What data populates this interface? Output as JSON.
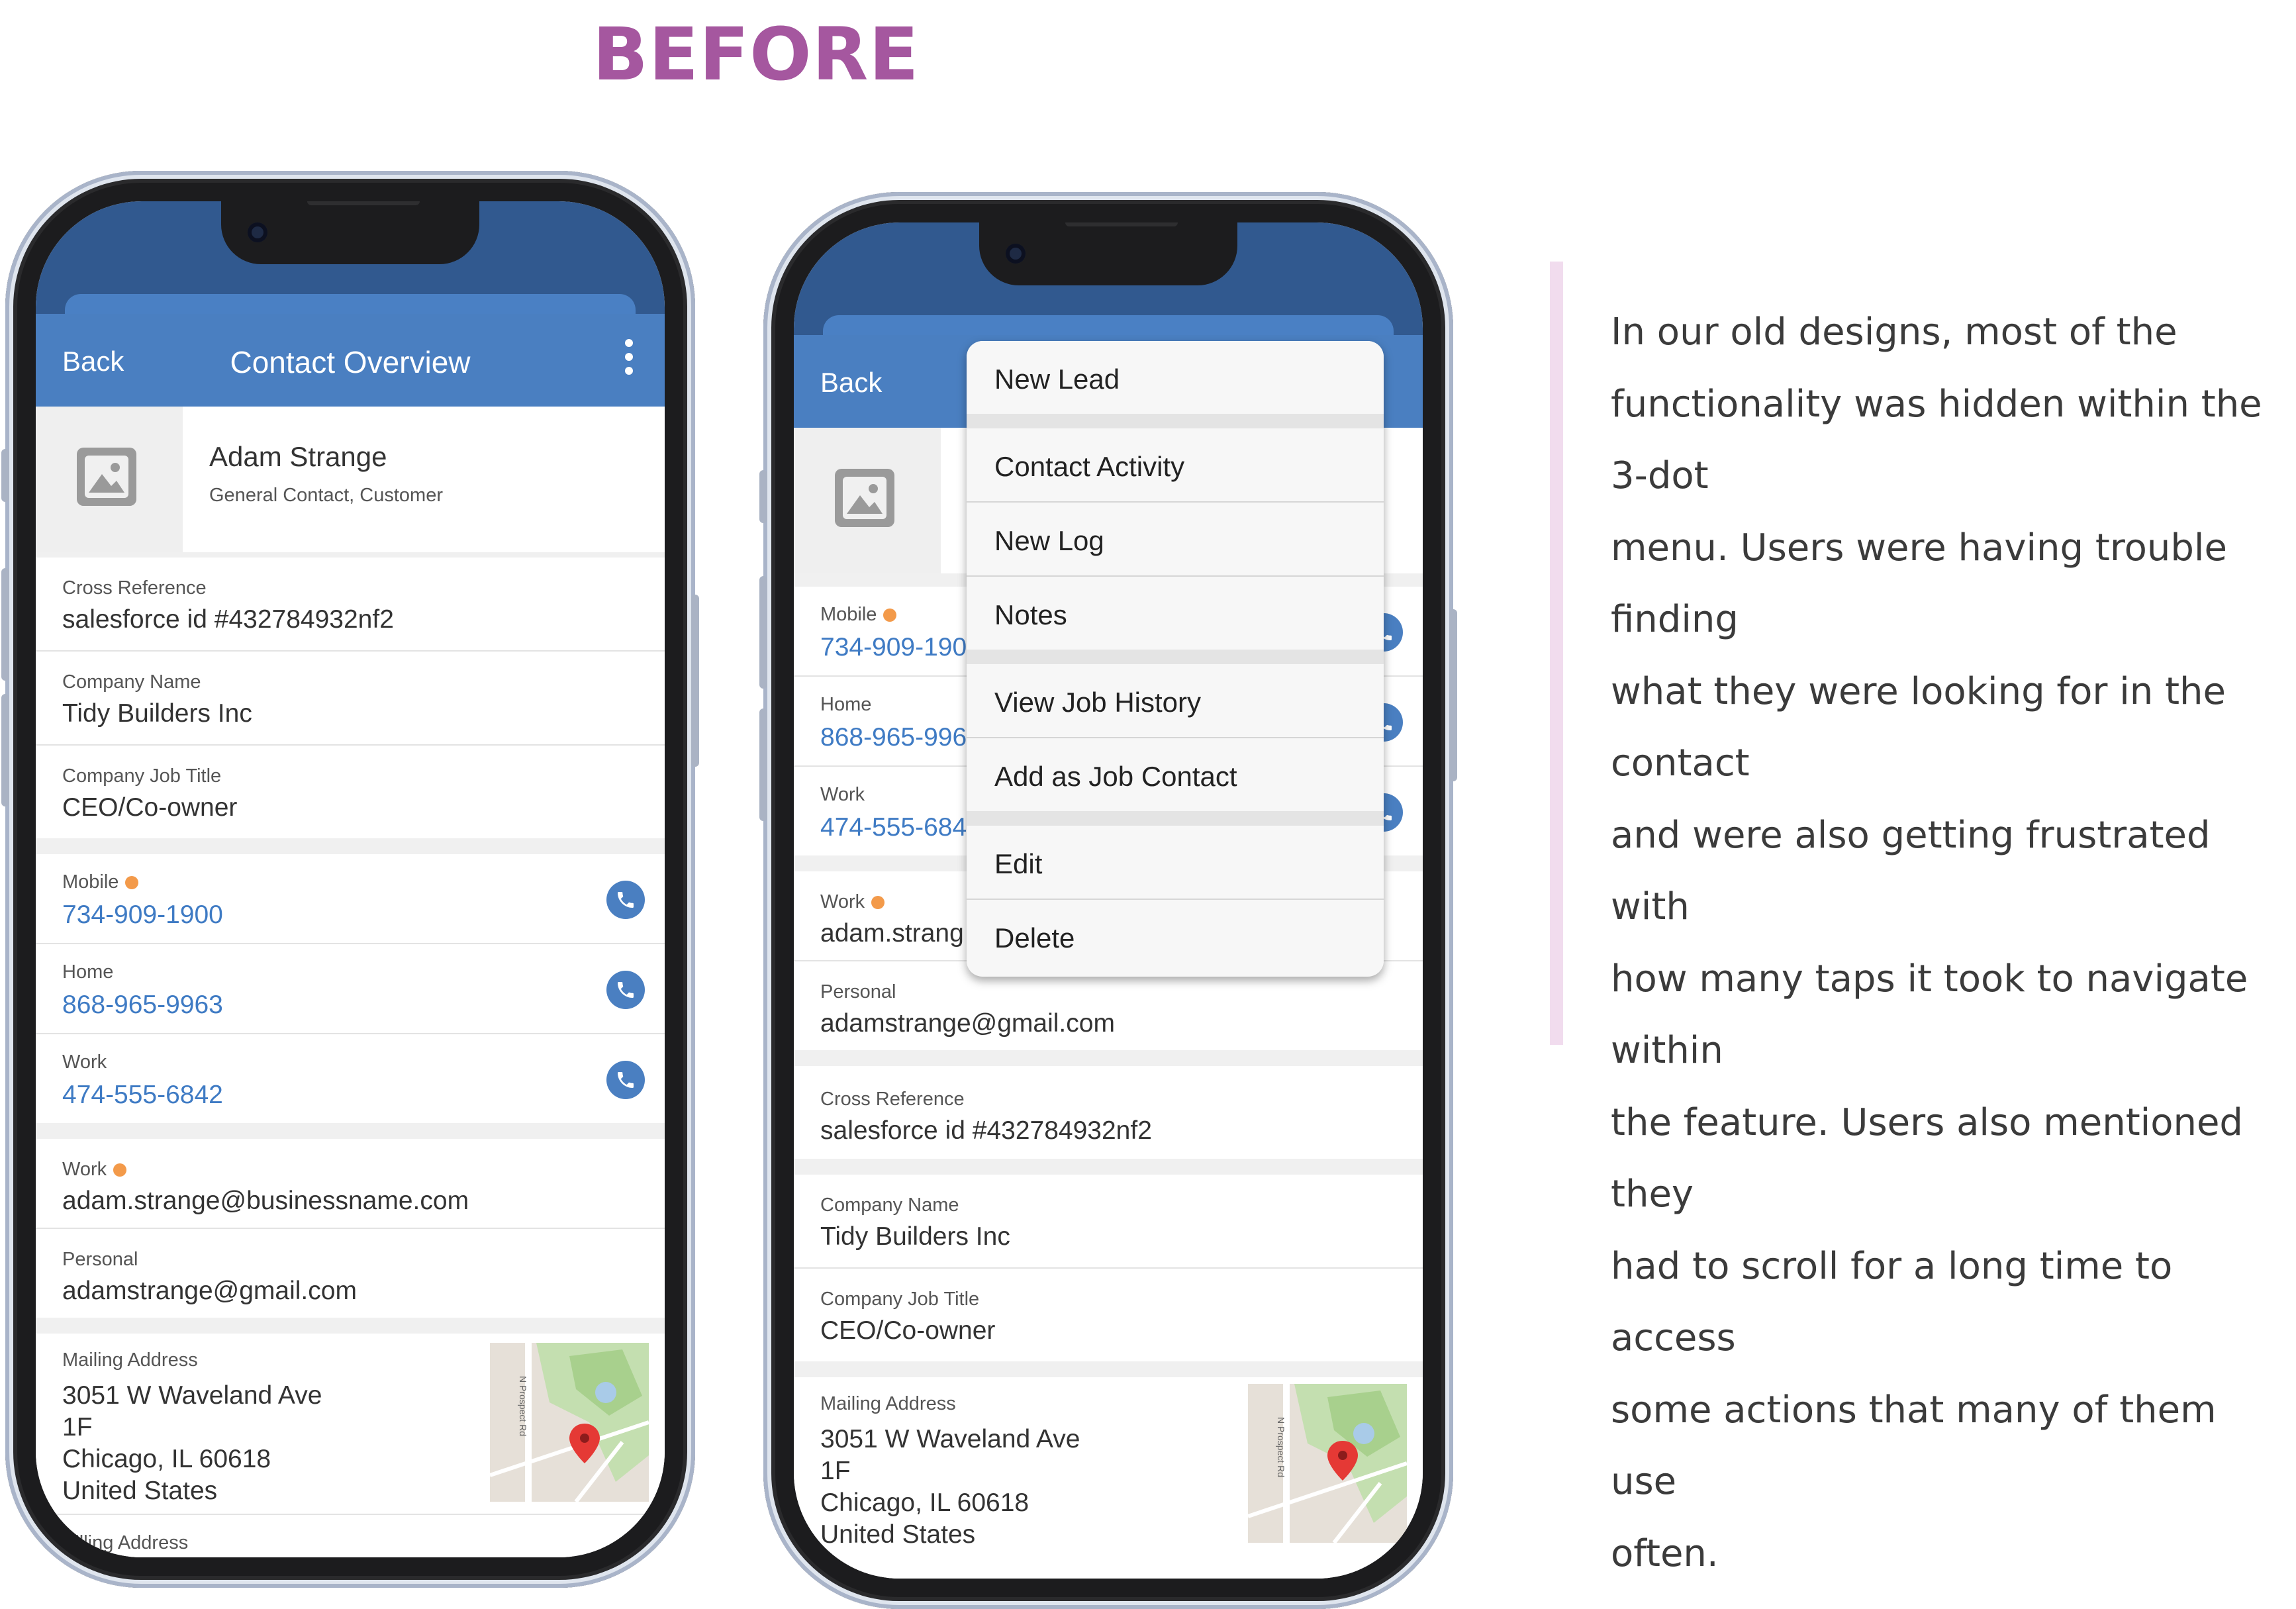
{
  "heading": "BEFORE",
  "phone1": {
    "back": "Back",
    "title": "Contact Overview",
    "name": "Adam Strange",
    "subtitle": "General Contact, Customer",
    "fields": [
      {
        "label": "Cross Reference",
        "value": "salesforce id #432784932nf2"
      },
      {
        "label": "Company Name",
        "value": "Tidy Builders Inc"
      },
      {
        "label": "Company Job Title",
        "value": "CEO/Co-owner"
      }
    ],
    "phones": [
      {
        "label": "Mobile",
        "value": "734-909-1900"
      },
      {
        "label": "Home",
        "value": "868-965-9963"
      },
      {
        "label": "Work",
        "value": "474-555-6842"
      }
    ],
    "emails": [
      {
        "label": "Work",
        "value": "adam.strange@businessname.com"
      },
      {
        "label": "Personal",
        "value": "adamstrange@gmail.com"
      }
    ],
    "mailing": {
      "label": "Mailing Address",
      "line1": "3051 W Waveland Ave",
      "line2": "1F",
      "line3": "Chicago, IL 60618",
      "line4": "United States"
    },
    "billing_label": "Billing Address",
    "map_road": "N Prospect Rd"
  },
  "phone2": {
    "back": "Back",
    "phones": [
      {
        "label": "Mobile",
        "value": "734-909-190"
      },
      {
        "label": "Home",
        "value": "868-965-996"
      },
      {
        "label": "Work",
        "value": "474-555-684"
      }
    ],
    "email_work": {
      "label": "Work",
      "value": "adam.strang"
    },
    "email_personal": {
      "label": "Personal",
      "value": "adamstrange@gmail.com"
    },
    "fields": [
      {
        "label": "Cross Reference",
        "value": "salesforce id #432784932nf2"
      },
      {
        "label": "Company Name",
        "value": "Tidy Builders Inc"
      },
      {
        "label": "Company Job Title",
        "value": "CEO/Co-owner"
      }
    ],
    "mailing": {
      "label": "Mailing Address",
      "line1": "3051 W Waveland Ave",
      "line2": "1F",
      "line3": "Chicago, IL 60618",
      "line4": "United States"
    },
    "map_road": "N Prospect Rd"
  },
  "menu": {
    "items": [
      "New Lead",
      "Contact Activity",
      "New Log",
      "Notes",
      "View Job History",
      "Add as Job Contact",
      "Edit",
      "Delete"
    ]
  },
  "description": [
    "In our old designs, most of the",
    "functionality was hidden within the 3-dot",
    "menu. Users were having trouble finding",
    "what they were looking for in the contact",
    "and were also getting frustrated with",
    "how many taps it took to navigate within",
    "the feature. Users also mentioned they",
    "had to scroll for a long time to access",
    "some actions that many of them use",
    "often."
  ],
  "colors": {
    "heading": "#a5579f",
    "app_bar": "#4a7fc1",
    "link": "#3f7bc4",
    "status_dot": "#f39a4a",
    "divider": "#f1dcee"
  }
}
